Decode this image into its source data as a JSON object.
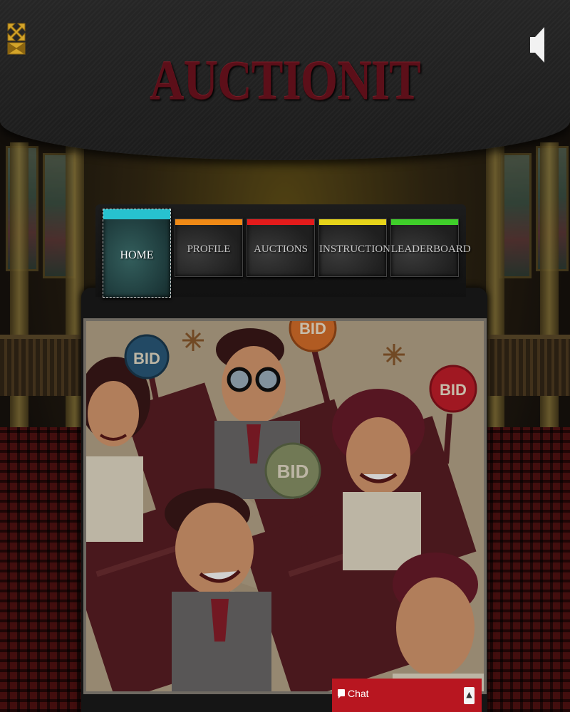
{
  "header": {
    "logo_text": "AUCTIONIT",
    "fullscreen_icon": "fullscreen-arrows-icon",
    "sound_icon": "speaker-icon"
  },
  "nav": {
    "tabs": [
      {
        "label": "HOME",
        "color": "#27c2cf",
        "active": true
      },
      {
        "label": "PROFILE",
        "color": "#f08a16",
        "active": false
      },
      {
        "label": "AUCTIONS",
        "color": "#e41b1b",
        "active": false
      },
      {
        "label": "INSTRUCTIONS",
        "color": "#e6d41a",
        "active": false
      },
      {
        "label": "LEADERBOARD",
        "color": "#3fcf2a",
        "active": false
      }
    ]
  },
  "illustration": {
    "paddles": [
      "BID",
      "BID",
      "BID",
      "BID"
    ]
  },
  "chat": {
    "label": "Chat",
    "toggle_icon": "chevron-up-icon"
  },
  "colors": {
    "brand": "#5c0f19",
    "chat_bg": "#b81620"
  }
}
